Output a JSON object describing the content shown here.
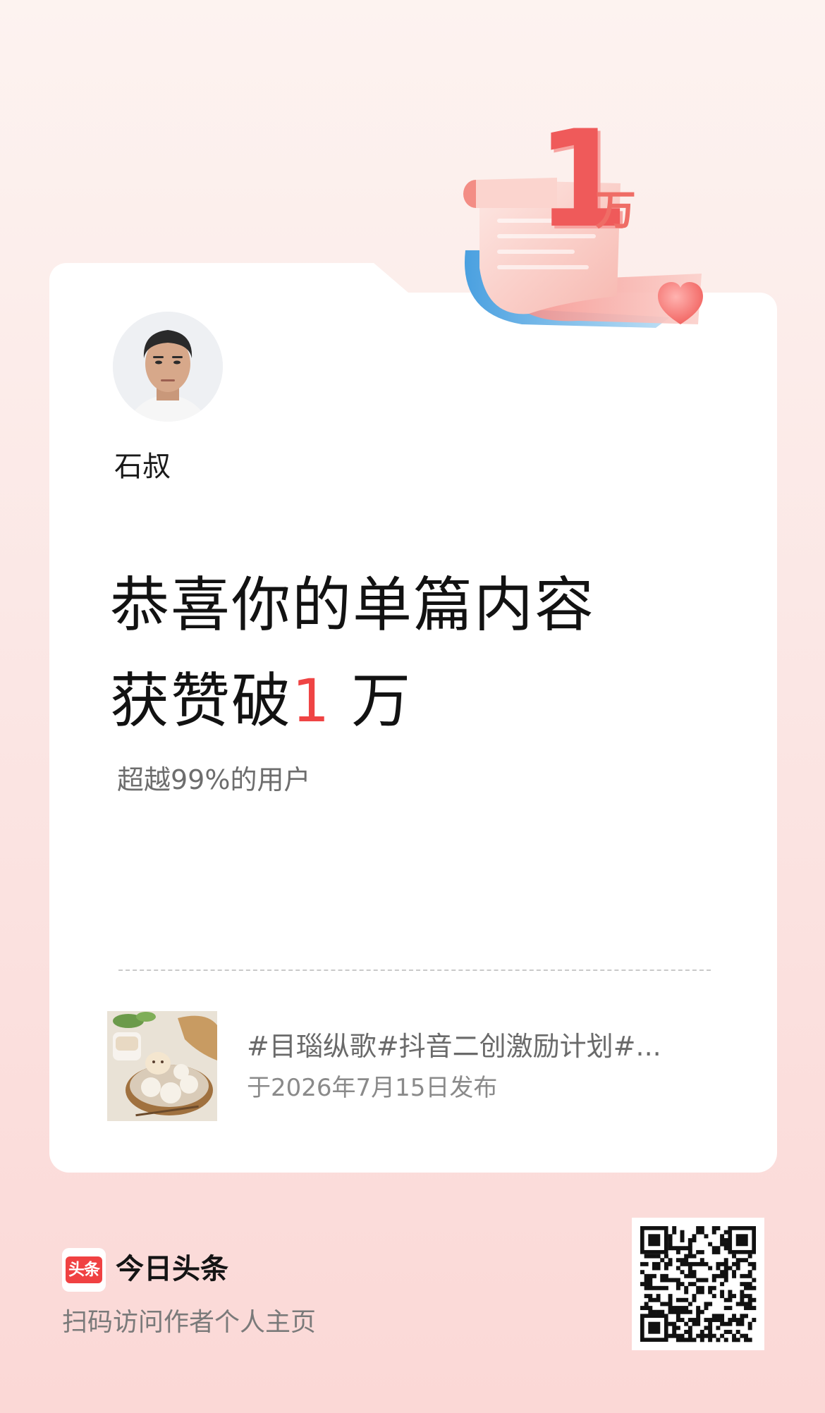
{
  "badge": {
    "number": "1",
    "unit": "万"
  },
  "author": {
    "name": "石叔"
  },
  "headline": {
    "line1": "恭喜你的单篇内容",
    "line2_prefix": "获赞破",
    "line2_highlight": "1",
    "line2_suffix": "万"
  },
  "subtext": "超越99%的用户",
  "content": {
    "title": "#目瑙纵歌#抖音二创激励计划#...",
    "publish_date": "于2026年7月15日发布"
  },
  "footer": {
    "logo_text": "头条",
    "brand_name": "今日头条",
    "caption": "扫码访问作者个人主页"
  },
  "colors": {
    "accent": "#ef4444",
    "brand": "#f04142"
  }
}
